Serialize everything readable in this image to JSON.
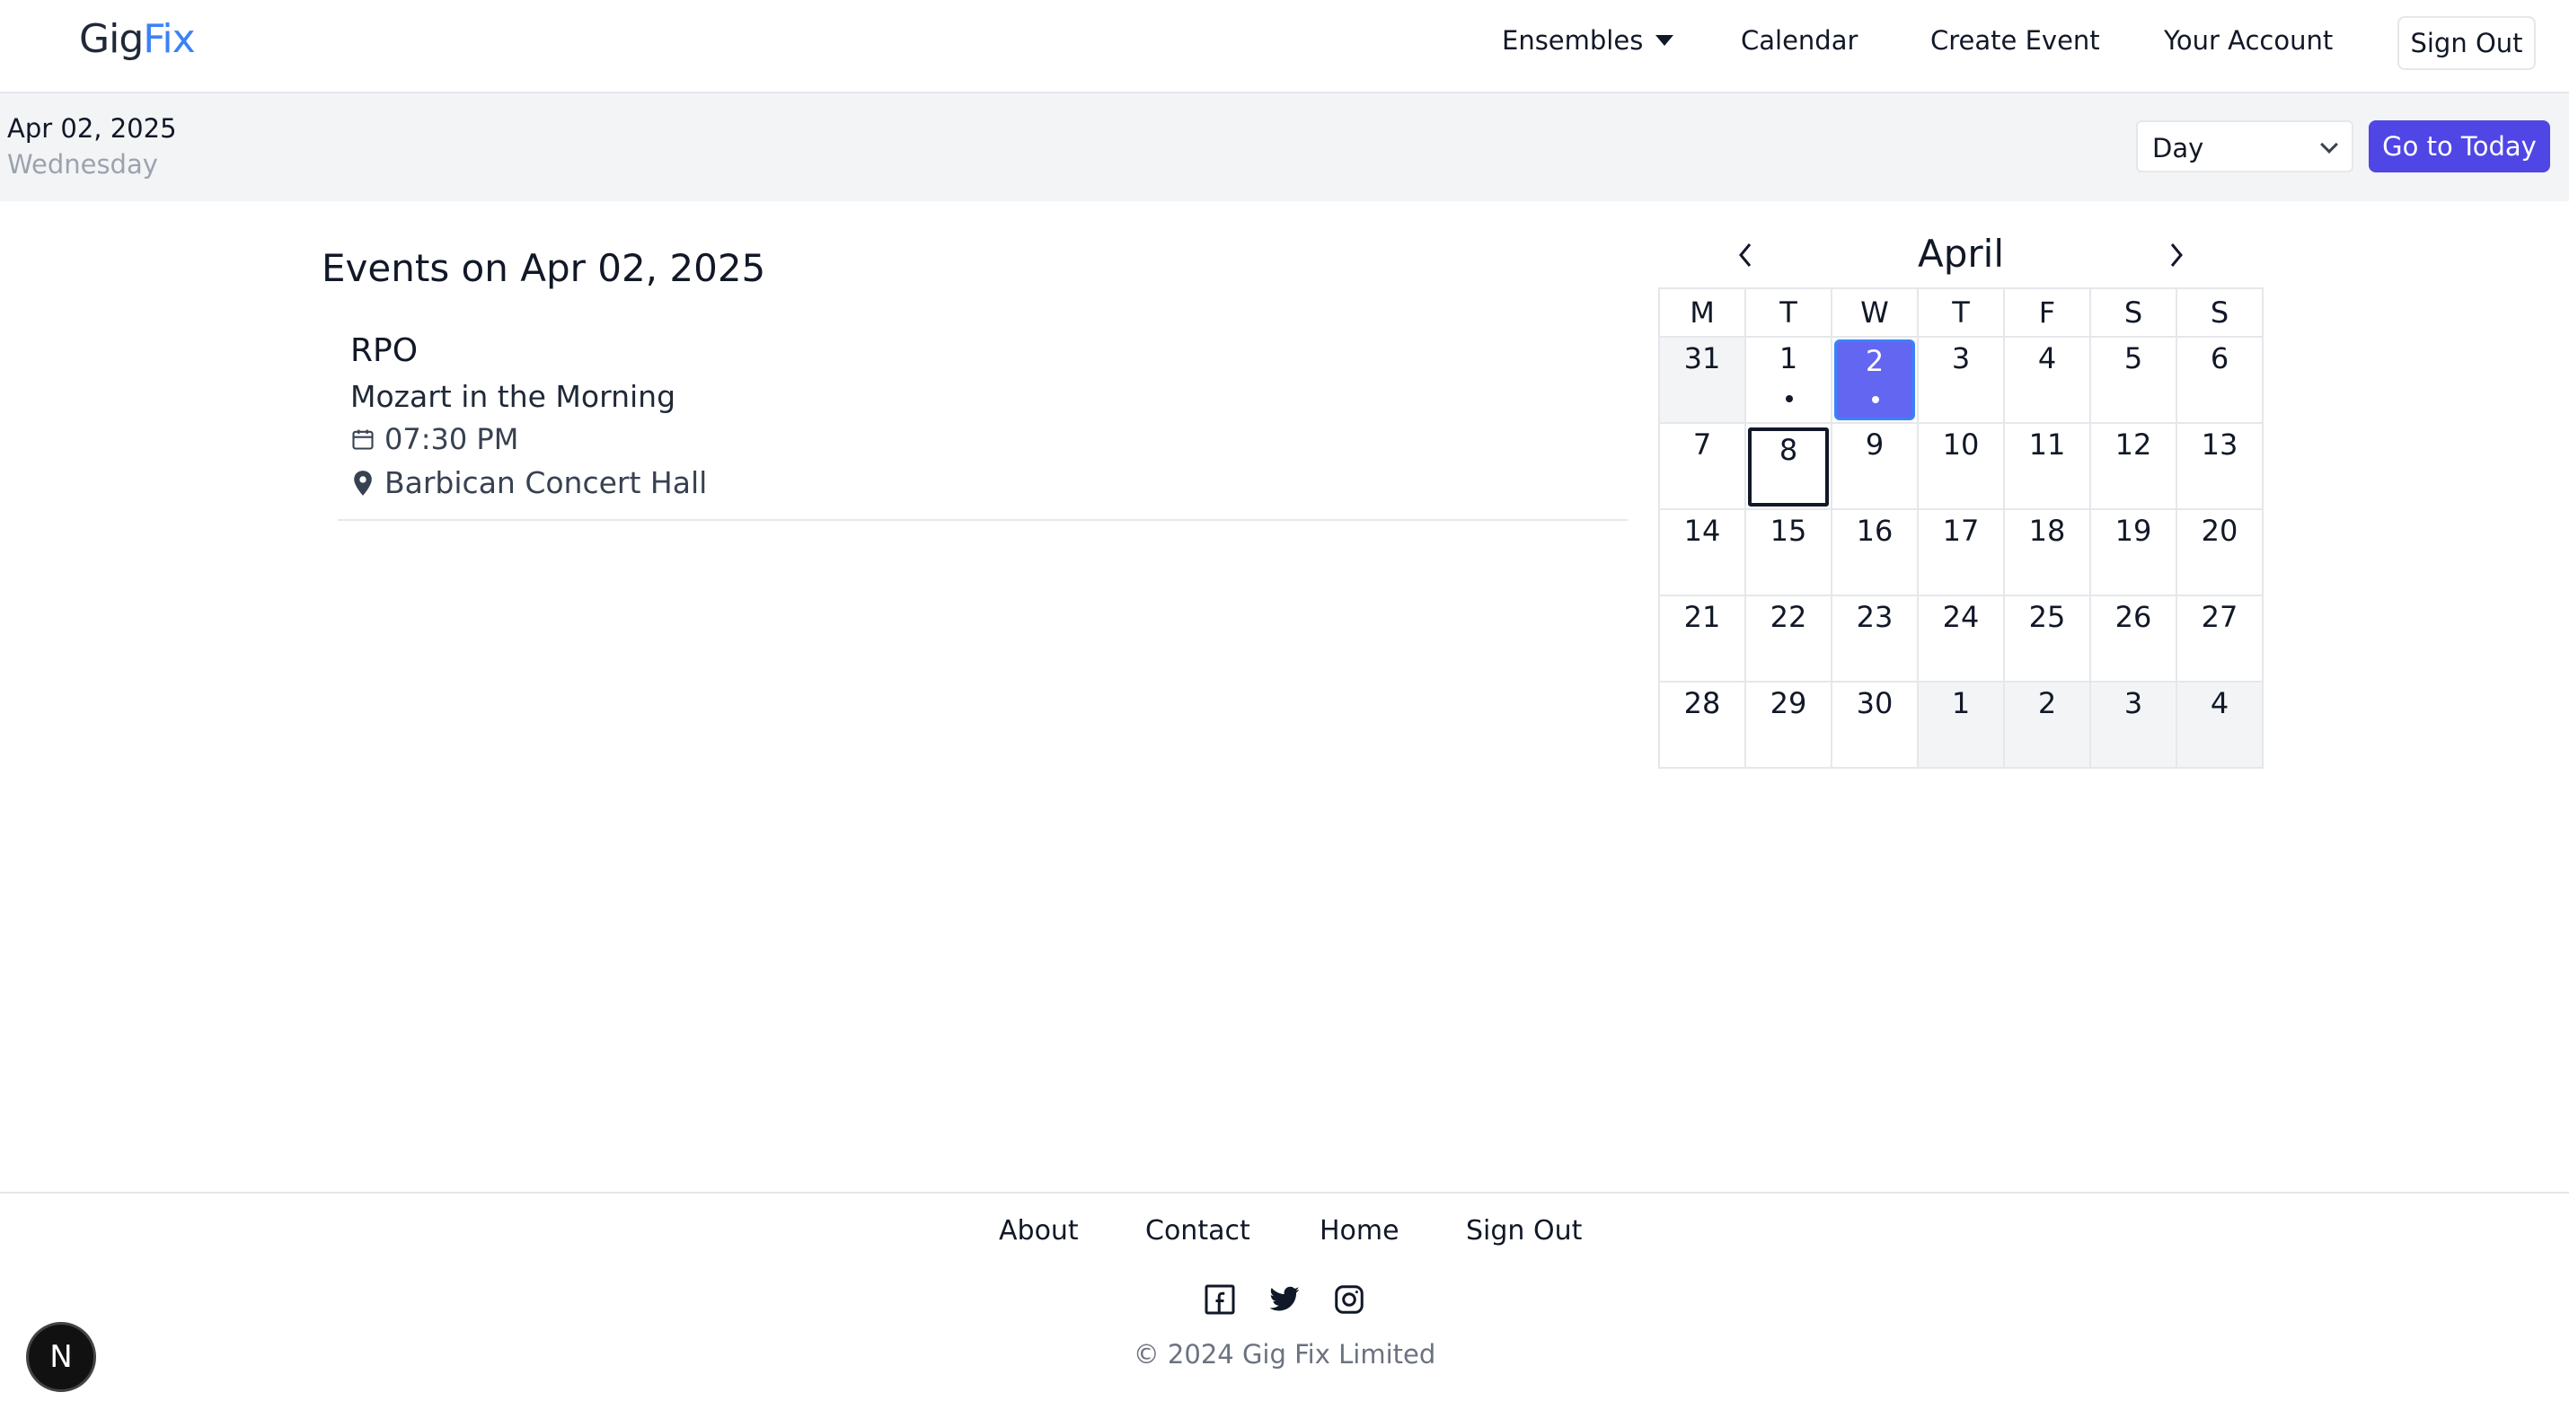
{
  "navbar": {
    "logo_part1": "Gig",
    "logo_part2": "Fix",
    "links": {
      "ensembles": "Ensembles",
      "calendar": "Calendar",
      "create_event": "Create Event",
      "account": "Your Account",
      "sign_out": "Sign Out"
    }
  },
  "subheader": {
    "date": "Apr 02, 2025",
    "weekday": "Wednesday",
    "view_select": {
      "selected": "Day"
    },
    "today_button": "Go to Today",
    "accent_color": "#4f46e5"
  },
  "events": {
    "heading": "Events on Apr 02, 2025",
    "items": [
      {
        "ensemble": "RPO",
        "name": "Mozart in the Morning",
        "time": "07:30 PM",
        "location": "Barbican Concert Hall"
      }
    ]
  },
  "calendar": {
    "month": "April",
    "weekdays": [
      "M",
      "T",
      "W",
      "T",
      "F",
      "S",
      "S"
    ],
    "weeks": [
      [
        "31",
        "1",
        "2",
        "3",
        "4",
        "5",
        "6"
      ],
      [
        "7",
        "8",
        "9",
        "10",
        "11",
        "12",
        "13"
      ],
      [
        "14",
        "15",
        "16",
        "17",
        "18",
        "19",
        "20"
      ],
      [
        "21",
        "22",
        "23",
        "24",
        "25",
        "26",
        "27"
      ],
      [
        "28",
        "29",
        "30",
        "1",
        "2",
        "3",
        "4"
      ]
    ],
    "selected_color": "#6366f1"
  },
  "footer": {
    "links": {
      "about": "About",
      "contact": "Contact",
      "home": "Home",
      "sign_out": "Sign Out"
    },
    "social_icons": [
      "facebook-icon",
      "twitter-icon",
      "instagram-icon"
    ],
    "copyright": "© 2024 Gig Fix Limited"
  },
  "dev_badge": "N"
}
